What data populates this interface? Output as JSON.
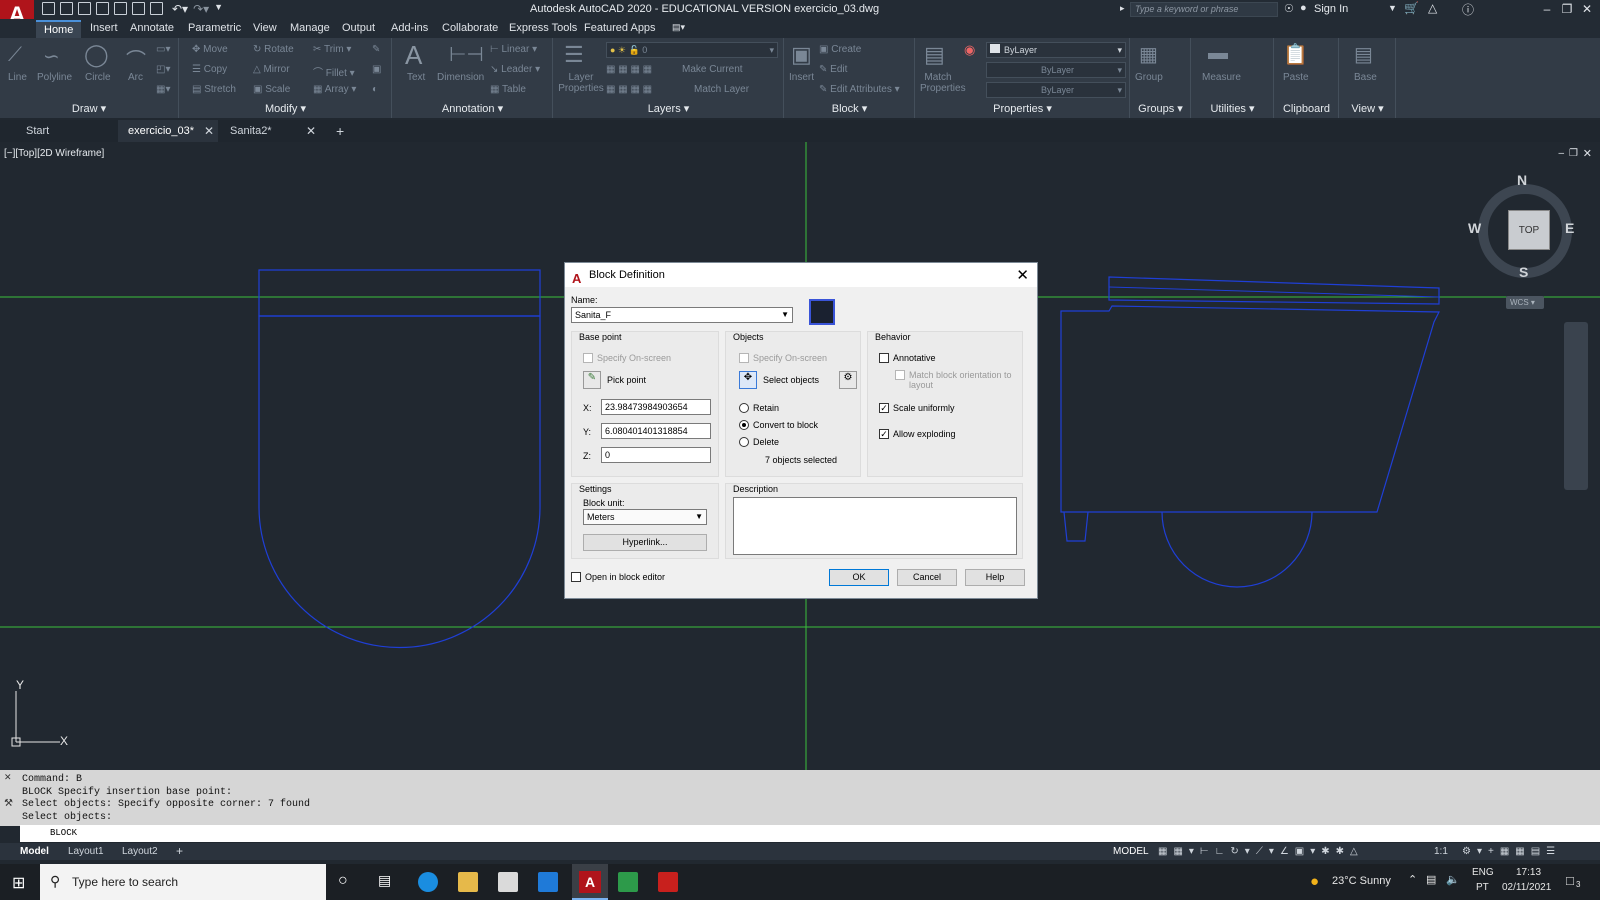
{
  "window": {
    "title": "Autodesk AutoCAD 2020 - EDUCATIONAL VERSION    exercicio_03.dwg",
    "search_placeholder": "Type a keyword or phrase",
    "sign_in": "Sign In"
  },
  "menu": [
    "Home",
    "Insert",
    "Annotate",
    "Parametric",
    "View",
    "Manage",
    "Output",
    "Add-ins",
    "Collaborate",
    "Express Tools",
    "Featured Apps"
  ],
  "ribbon": {
    "draw": {
      "title": "Draw",
      "tools": [
        "Line",
        "Polyline",
        "Circle",
        "Arc"
      ]
    },
    "modify": {
      "title": "Modify",
      "tools": [
        "Move",
        "Rotate",
        "Trim",
        "Copy",
        "Mirror",
        "Fillet",
        "Stretch",
        "Scale",
        "Array"
      ]
    },
    "annotation": {
      "title": "Annotation",
      "tools": [
        "Text",
        "Dimension",
        "Linear",
        "Leader",
        "Table"
      ]
    },
    "layers": {
      "title": "Layers",
      "tools": [
        "Layer Properties",
        "Make Current",
        "Match Layer"
      ],
      "current": "0"
    },
    "block": {
      "title": "Block",
      "tools": [
        "Insert",
        "Create",
        "Edit",
        "Edit Attributes"
      ]
    },
    "properties": {
      "title": "Properties",
      "tools": [
        "Match Properties"
      ],
      "color": "ByLayer",
      "linetype": "ByLayer",
      "lineweight": "ByLayer"
    },
    "groups": {
      "title": "Groups",
      "tools": [
        "Group"
      ]
    },
    "utilities": {
      "title": "Utilities",
      "tools": [
        "Measure"
      ]
    },
    "clipboard": {
      "title": "Clipboard",
      "tools": [
        "Paste"
      ]
    },
    "view": {
      "title": "View",
      "tools": [
        "Base"
      ]
    }
  },
  "file_tabs": [
    "Start",
    "exercicio_03*",
    "Sanita2*"
  ],
  "viewport": {
    "label": "[−][Top][2D Wireframe]",
    "viewcube": {
      "n": "N",
      "s": "S",
      "e": "E",
      "w": "W",
      "face": "TOP",
      "ucs": "WCS"
    }
  },
  "dialog": {
    "title": "Block Definition",
    "name_label": "Name:",
    "name_value": "Sanita_F",
    "base_point": {
      "title": "Base point",
      "specify": "Specify On-screen",
      "pick": "Pick point",
      "x_label": "X:",
      "x": "23.98473984903654",
      "y_label": "Y:",
      "y": "6.080401401318854",
      "z_label": "Z:",
      "z": "0"
    },
    "objects": {
      "title": "Objects",
      "specify": "Specify On-screen",
      "select": "Select objects",
      "retain": "Retain",
      "convert": "Convert to block",
      "delete": "Delete",
      "count": "7 objects selected"
    },
    "behavior": {
      "title": "Behavior",
      "annotative": "Annotative",
      "match": "Match block orientation to layout",
      "scale": "Scale uniformly",
      "explode": "Allow exploding"
    },
    "settings": {
      "title": "Settings",
      "unit_label": "Block unit:",
      "unit": "Meters",
      "hyperlink": "Hyperlink..."
    },
    "description": {
      "title": "Description",
      "text": ""
    },
    "open_editor": "Open in block editor",
    "ok": "OK",
    "cancel": "Cancel",
    "help": "Help"
  },
  "command": {
    "history": [
      "Command: B",
      "BLOCK Specify insertion base point:",
      "Select objects: Specify opposite corner: 7 found",
      "Select objects:"
    ],
    "input": "BLOCK"
  },
  "layout_tabs": [
    "Model",
    "Layout1",
    "Layout2"
  ],
  "status": {
    "model": "MODEL",
    "scale": "1:1"
  },
  "taskbar": {
    "search": "Type here to search",
    "weather": "23°C  Sunny",
    "lang1": "ENG",
    "lang2": "PT",
    "time": "17:13",
    "date": "02/11/2021",
    "notif": "3"
  }
}
